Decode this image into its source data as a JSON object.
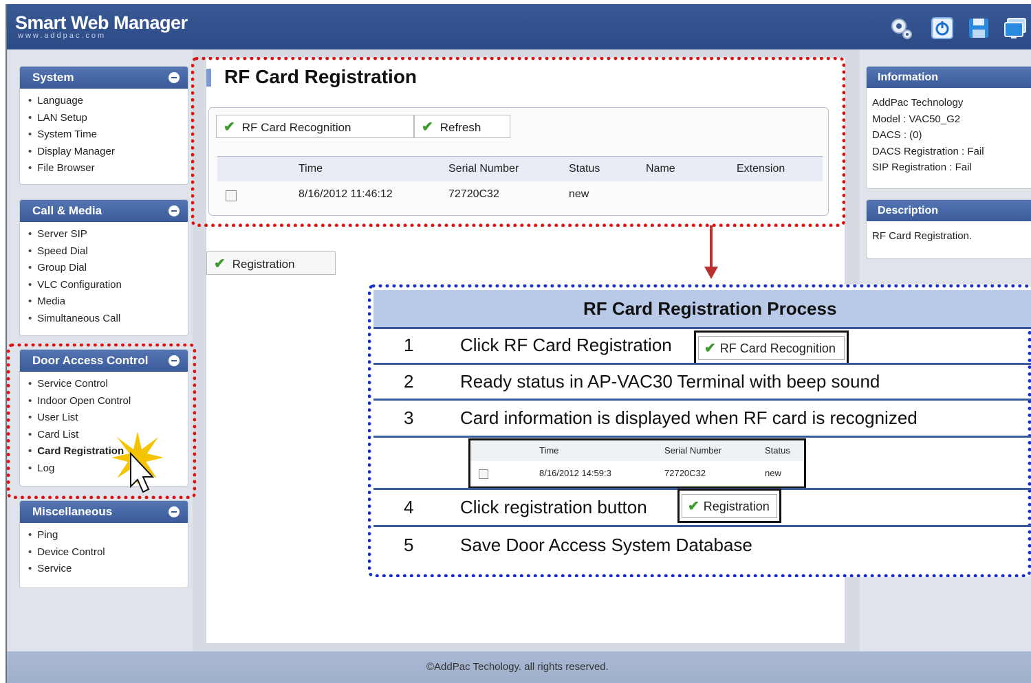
{
  "app": {
    "title": "Smart Web Manager",
    "subtitle": "www.addpac.com"
  },
  "header_icons": [
    "gear-icon",
    "power-icon",
    "save-icon",
    "monitor-icon"
  ],
  "sidebar": {
    "system": {
      "title": "System",
      "items": [
        "Language",
        "LAN Setup",
        "System Time",
        "Display Manager",
        "File Browser"
      ]
    },
    "call_media": {
      "title": "Call & Media",
      "items": [
        "Server SIP",
        "Speed Dial",
        "Group Dial",
        "VLC Configuration",
        "Media",
        "Simultaneous Call"
      ]
    },
    "door_access": {
      "title": "Door Access Control",
      "items": [
        "Service Control",
        "Indoor Open Control",
        "User List",
        "Card List",
        "Card Registration",
        "Log"
      ]
    },
    "misc": {
      "title": "Miscellaneous",
      "items": [
        "Ping",
        "Device Control",
        "Service"
      ]
    }
  },
  "main": {
    "title": "RF Card Registration",
    "buttons": {
      "recognition": "RF Card Recognition",
      "refresh": "Refresh",
      "registration": "Registration"
    },
    "table": {
      "headers": [
        "Time",
        "Serial Number",
        "Status",
        "Name",
        "Extension"
      ],
      "rows": [
        {
          "time": "8/16/2012 11:46:12",
          "serial": "72720C32",
          "status": "new",
          "name": "",
          "extension": ""
        }
      ]
    }
  },
  "info": {
    "title": "Information",
    "lines": [
      "AddPac Technology",
      "Model : VAC50_G2",
      "DACS : (0)",
      "DACS Registration : Fail",
      "SIP Registration : Fail"
    ]
  },
  "description": {
    "title": "Description",
    "text": "RF Card Registration."
  },
  "footer": "©AddPac Techology. all rights reserved.",
  "process": {
    "title": "RF Card Registration Process",
    "steps": [
      {
        "num": "1",
        "text": "Click RF Card Registration"
      },
      {
        "num": "2",
        "text": "Ready status in AP-VAC30 Terminal  with beep sound"
      },
      {
        "num": "3",
        "text": "Card information is displayed when RF card is recognized"
      },
      {
        "num": "4",
        "text": "Click registration button"
      },
      {
        "num": "5",
        "text": "Save Door Access System Database"
      }
    ],
    "button1": "RF Card Recognition",
    "button4": "Registration",
    "mini_table": {
      "headers": [
        "Time",
        "Serial Number",
        "Status"
      ],
      "row": {
        "time": "8/16/2012 14:59:3",
        "serial": "72720C32",
        "status": "new"
      }
    }
  },
  "colors": {
    "header": "#2b4a86",
    "highlight_red": "#e01010",
    "highlight_blue": "#1a2fd0"
  }
}
